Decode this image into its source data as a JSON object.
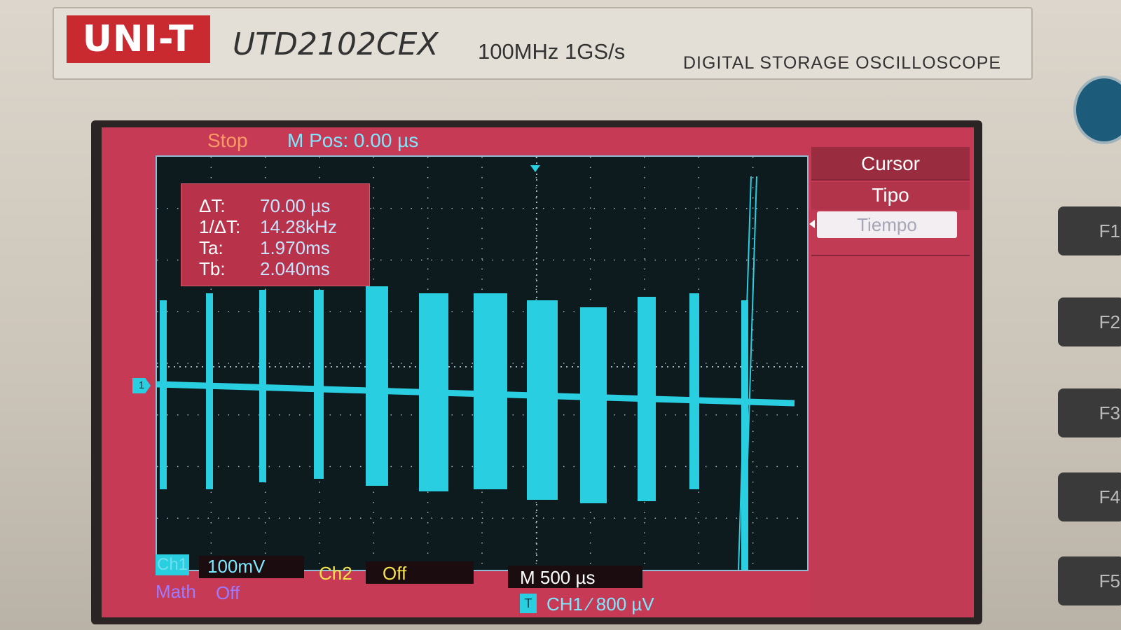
{
  "device": {
    "logo": "UNI-T",
    "model": "UTD2102CEX",
    "spec": "100MHz  1GS/s",
    "kind": "DIGITAL STORAGE OSCILLOSCOPE"
  },
  "status": {
    "run_state": "Stop",
    "m_pos": "M Pos: 0.00 µs"
  },
  "cursor_readout": {
    "rows": [
      {
        "label": "ΔT:",
        "value": "70.00 µs"
      },
      {
        "label": "1/ΔT:",
        "value": "14.28kHz"
      },
      {
        "label": "Ta:",
        "value": "1.970ms"
      },
      {
        "label": "Tb:",
        "value": "2.040ms"
      }
    ]
  },
  "menu": {
    "title": "Cursor",
    "type_label": "Tipo",
    "type_value": "Tiempo"
  },
  "channels": {
    "ch1_tag": "Ch1",
    "ch1_scale": "100mV",
    "ch2_label": "Ch2",
    "ch2_state": "Off",
    "math_label": "Math",
    "math_state": "Off",
    "ch1_marker": "1"
  },
  "timebase": {
    "label": "M 500 µs"
  },
  "trigger": {
    "badge": "T",
    "text": "CH1  ∕  800 µV"
  },
  "softkeys": [
    "F1",
    "F2",
    "F3",
    "F4",
    "F5"
  ],
  "colors": {
    "screen_bg": "#c63a55",
    "grid_bg": "#0d1a1e",
    "trace": "#29cfe0",
    "ch2": "#f4e24a",
    "math": "#9c7bff",
    "stop": "#ff9a66"
  }
}
